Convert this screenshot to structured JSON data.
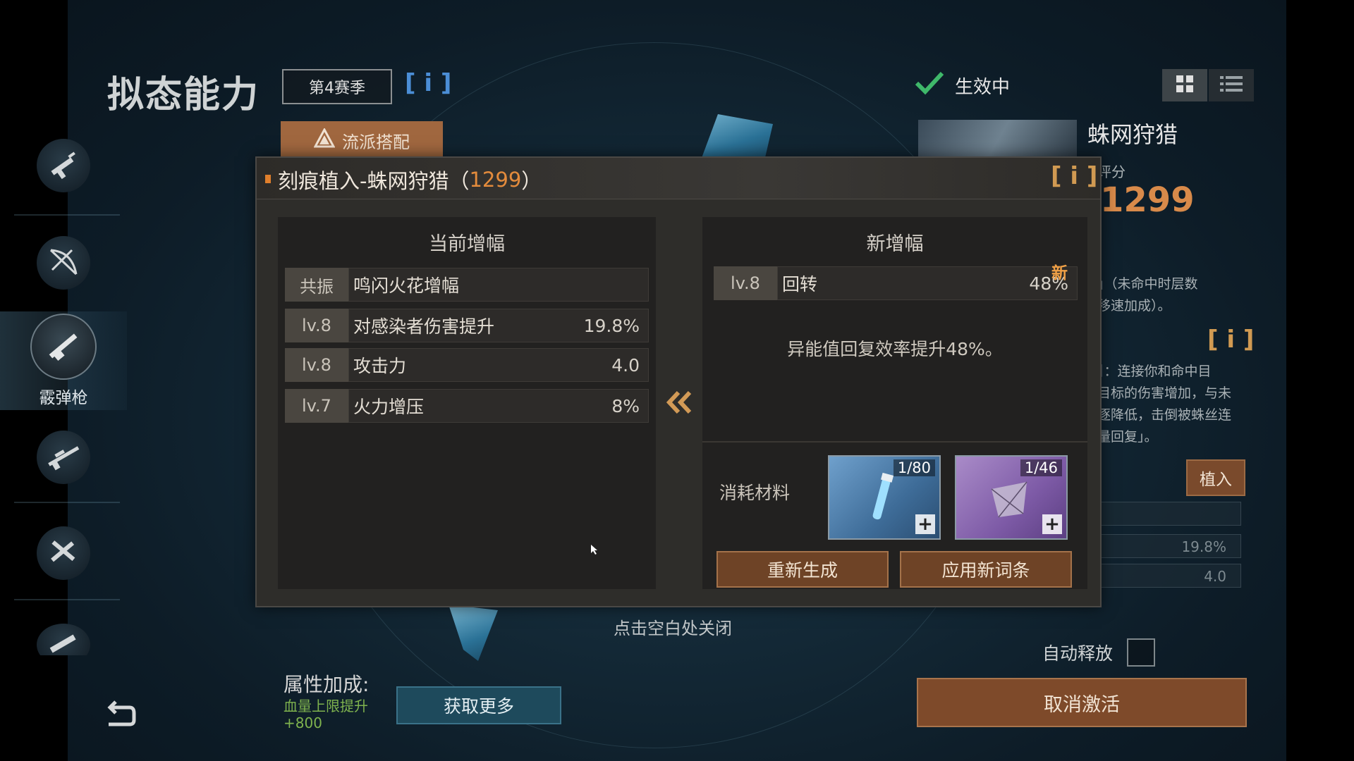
{
  "header": {
    "title": "拟态能力",
    "season": "第4赛季",
    "info_blue": "[ i ]",
    "school_button": "流派搭配",
    "status": "生效中"
  },
  "rail": {
    "items": [
      {
        "icon": "assault-rifle-icon",
        "label": ""
      },
      {
        "icon": "crossbow-icon",
        "label": ""
      },
      {
        "icon": "shotgun-icon",
        "label": "霰弹枪"
      },
      {
        "icon": "sniper-rifle-icon",
        "label": ""
      },
      {
        "icon": "dual-pistols-icon",
        "label": ""
      },
      {
        "icon": "launcher-icon",
        "label": ""
      }
    ]
  },
  "right_panel": {
    "title": "蛛网狩猎",
    "score_label": "评分",
    "score": "1299",
    "desc1_line1": "」（未命中时层数",
    "desc1_line2": "移速加成）。",
    "info": "[ i ]",
    "desc2_line1": "】：连接你和命中目",
    "desc2_line2": "目标的伤害增加，与未",
    "desc2_line3": "逐降低，击倒被蛛丝连",
    "desc2_line4": "量回复」。",
    "implant_button": "植入",
    "row_values": [
      "19.8%",
      "4.0"
    ],
    "auto_release": "自动释放",
    "deactivate_button": "取消激活"
  },
  "modal": {
    "title_prefix": "刻痕植入-蛛网狩猎（",
    "title_num": "1299",
    "title_suffix": "）",
    "info": "[ i ]",
    "current": {
      "heading": "当前增幅",
      "rows": [
        {
          "tag": "共振",
          "name": "鸣闪火花增幅",
          "value": ""
        },
        {
          "tag": "lv.8",
          "name": "对感染者伤害提升",
          "value": "19.8%"
        },
        {
          "tag": "lv.8",
          "name": "攻击力",
          "value": "4.0"
        },
        {
          "tag": "lv.7",
          "name": "火力增压",
          "value": "8%"
        }
      ]
    },
    "new": {
      "heading": "新增幅",
      "row": {
        "tag": "lv.8",
        "name": "回转",
        "value": "48%"
      },
      "new_badge": "新",
      "description": "异能值回复效率提升48%。",
      "materials_label": "消耗材料",
      "materials": [
        {
          "icon": "crystal-vial-icon",
          "count": "1/80",
          "color": "#4f86b8"
        },
        {
          "icon": "web-shard-icon",
          "count": "1/46",
          "color": "#8a64a8"
        }
      ],
      "regenerate_button": "重新生成",
      "apply_button": "应用新词条"
    }
  },
  "footer": {
    "close_hint": "点击空白处关闭",
    "attr_label": "属性加成:",
    "attr_bonus_line1": "血量上限提升",
    "attr_bonus_line2": "+800",
    "more_button": "获取更多"
  },
  "colors": {
    "accent_orange": "#e38b3c",
    "button_brown": "#6e4326",
    "active_green": "#3fb86a",
    "info_blue": "#4b8ed6"
  }
}
